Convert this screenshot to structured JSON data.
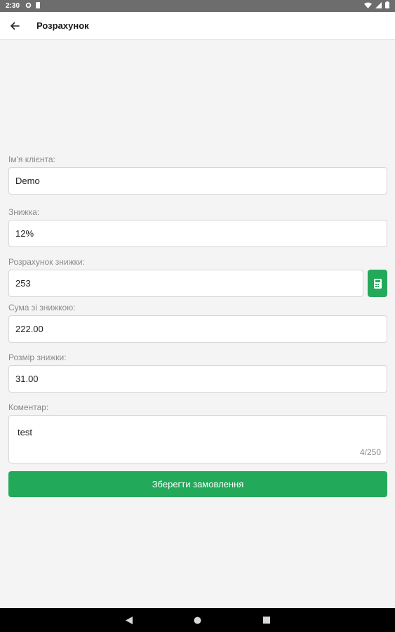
{
  "status_bar": {
    "time": "2:30"
  },
  "app_bar": {
    "title": "Розрахунок",
    "back_icon": "arrow-left-icon"
  },
  "form": {
    "client_name": {
      "label": "Ім'я клієнта:",
      "value": "Demo"
    },
    "discount": {
      "label": "Знижка:",
      "value": "12%"
    },
    "discount_calc": {
      "label": "Розрахунок знижки:",
      "value": "253",
      "button_icon": "calculator-icon"
    },
    "sum_with_discount": {
      "label": "Сума зі знижкою:",
      "value": "222.00"
    },
    "discount_amount": {
      "label": "Розмір знижки:",
      "value": "31.00"
    },
    "comment": {
      "label": "Коментар:",
      "value": "test",
      "counter": "4/250"
    },
    "save_button": "Зберегти замовлення"
  },
  "colors": {
    "accent": "#23a95a",
    "status_bar": "#6d6d6d",
    "nav_bar": "#000000"
  }
}
